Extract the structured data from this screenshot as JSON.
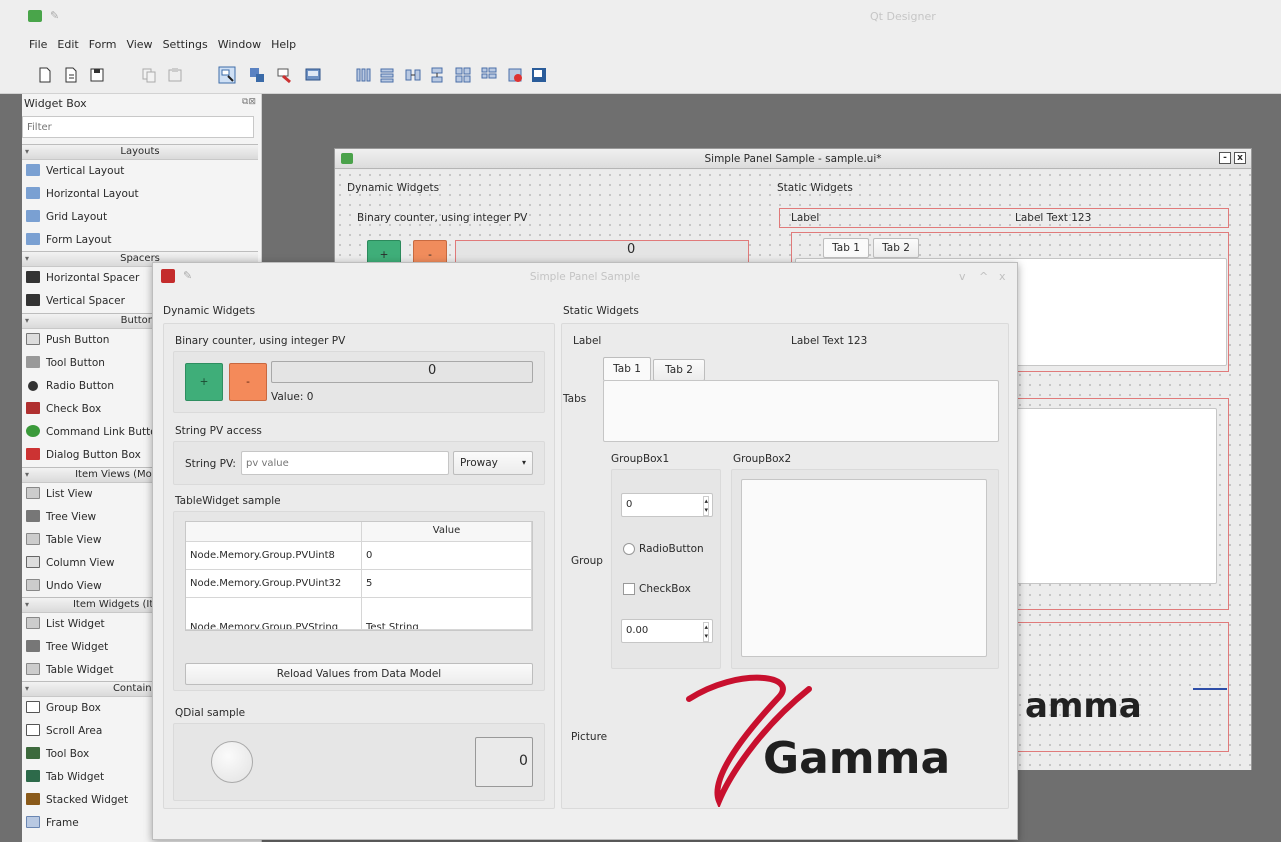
{
  "app": {
    "title": "Qt Designer",
    "menu": [
      "File",
      "Edit",
      "Form",
      "View",
      "Settings",
      "Window",
      "Help"
    ]
  },
  "toolbar": {
    "icons": [
      "new-form-icon",
      "open-form-icon",
      "save-form-icon",
      "copy-icon",
      "paste-icon",
      "edit-widgets-icon",
      "edit-signals-slots-icon",
      "edit-buddies-icon",
      "edit-tab-order-icon",
      "layout-horizontal-icon",
      "layout-vertical-icon",
      "layout-horizontal-splitter-icon",
      "layout-vertical-splitter-icon",
      "layout-grid-icon",
      "layout-form-icon",
      "break-layout-icon",
      "adjust-size-icon"
    ]
  },
  "widget_box": {
    "title": "Widget Box",
    "filter_placeholder": "Filter",
    "categories": {
      "layouts": "Layouts",
      "spacers": "Spacers",
      "buttons": "Buttons",
      "item_views": "Item Views (Model-Based)",
      "item_widgets": "Item Widgets (Item-Based)",
      "containers": "Containers"
    },
    "items": {
      "vertical_layout": "Vertical Layout",
      "horizontal_layout": "Horizontal Layout",
      "grid_layout": "Grid Layout",
      "form_layout": "Form Layout",
      "horizontal_spacer": "Horizontal Spacer",
      "vertical_spacer": "Vertical Spacer",
      "push_button": "Push Button",
      "tool_button": "Tool Button",
      "radio_button": "Radio Button",
      "check_box": "Check Box",
      "command_link_button": "Command Link Button",
      "dialog_button_box": "Dialog Button Box",
      "list_view": "List View",
      "tree_view": "Tree View",
      "table_view": "Table View",
      "column_view": "Column View",
      "undo_view": "Undo View",
      "list_widget": "List Widget",
      "tree_widget": "Tree Widget",
      "table_widget": "Table Widget",
      "group_box": "Group Box",
      "scroll_area": "Scroll Area",
      "tool_box": "Tool Box",
      "tab_widget": "Tab Widget",
      "stacked_widget": "Stacked Widget",
      "frame": "Frame"
    }
  },
  "form_window": {
    "title": "Simple Panel Sample - sample.ui*",
    "dynamic_widgets": "Dynamic Widgets",
    "static_widgets": "Static Widgets",
    "binary_counter": "Binary counter, using integer PV",
    "plus": "+",
    "minus": "-",
    "slider_glyph": "0",
    "label": "Label",
    "label_text": "Label Text 123",
    "tab1": "Tab 1",
    "tab2": "Tab 2",
    "gamma_text": "amma",
    "restore_btn": "-",
    "close_btn": "x"
  },
  "preview": {
    "title": "Simple Panel Sample",
    "window_controls": [
      "v",
      "^",
      "x"
    ],
    "dynamic_widgets": "Dynamic Widgets",
    "static_widgets": "Static Widgets",
    "binary_counter": {
      "title": "Binary counter, using integer PV",
      "plus": "+",
      "minus": "-",
      "slider_glyph": "0",
      "value_label": "Value: 0"
    },
    "string_pv": {
      "title": "String PV access",
      "label": "String PV:",
      "placeholder": "pv value",
      "combo_value": "Proway"
    },
    "table": {
      "title": "TableWidget sample",
      "header_value": "Value",
      "rows": [
        {
          "key": "Node.Memory.Group.PVUint8",
          "value": "0"
        },
        {
          "key": "Node.Memory.Group.PVUint32",
          "value": "5"
        },
        {
          "key": "Node.Memory.Group.PVString",
          "value": "Test String"
        }
      ],
      "reload_button": "Reload Values from Data Model"
    },
    "qdial": {
      "title": "QDial sample",
      "lcd_value": "0"
    },
    "static": {
      "label": "Label",
      "label_text": "Label Text 123",
      "tabs_label": "Tabs",
      "tab1": "Tab 1",
      "tab2": "Tab 2",
      "group_label": "Group",
      "groupbox1": "GroupBox1",
      "groupbox2": "GroupBox2",
      "spin_value": "0",
      "radio_label": "RadioButton",
      "checkbox_label": "CheckBox",
      "double_spin_value": "0.00",
      "picture_label": "Picture",
      "logo_text": "Gamma"
    }
  }
}
